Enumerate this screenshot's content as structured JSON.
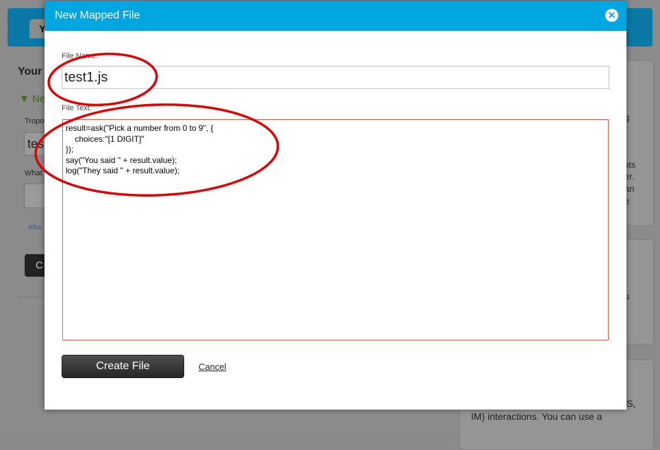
{
  "background": {
    "tab_label": "Y",
    "heading": "Your",
    "new_toggle": "▼ Ne",
    "field1_label": "Tropo",
    "field1_value": "tes",
    "field2_label": "What",
    "after_link": "After",
    "button_label": "C",
    "panel1_fragments": [
      "g",
      "pts",
      "er.",
      "an",
      "e"
    ],
    "panel2_fragments": [
      "u"
    ],
    "panel3_text": "ce (phone calls) and messaging (SMS, IM) interactions. You can use a"
  },
  "modal": {
    "title": "New Mapped File",
    "close_symbol": "✕",
    "file_name_label": "File Name:",
    "file_name_value": "test1.js",
    "file_text_label": "File Text:",
    "file_text_value": "result=ask(\"Pick a number from 0 to 9\", {\n    choices:\"[1 DIGIT]\"\n});\nsay(\"You said \" + result.value);\nlog(\"They said \" + result.value);",
    "create_button": "Create File",
    "cancel_link": "Cancel"
  },
  "colors": {
    "modal_header": "#00a6e0",
    "annotation_red": "#e00000",
    "textarea_border": "#e05a4a"
  },
  "icons": {
    "close": "close-icon"
  }
}
